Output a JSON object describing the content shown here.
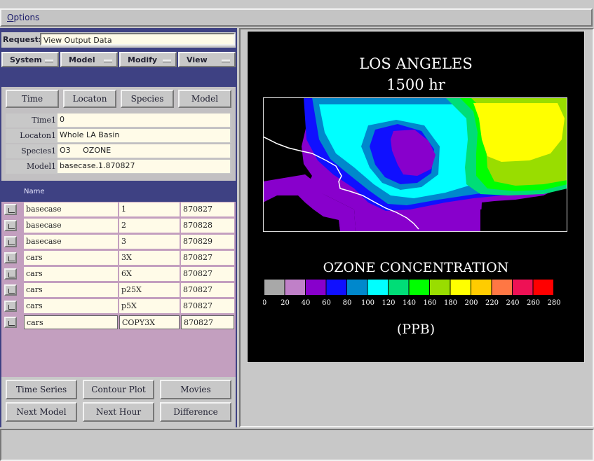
{
  "menubar": {
    "options_label": "Options",
    "options_mnemonic": "O",
    "options_rest": "ptions"
  },
  "request": {
    "label": "Request:",
    "value": "View Output Data"
  },
  "menus": [
    {
      "label": "System"
    },
    {
      "label": "Model"
    },
    {
      "label": "Modify"
    },
    {
      "label": "View"
    }
  ],
  "selectors": {
    "buttons": [
      "Time",
      "Locaton",
      "Species",
      "Model"
    ],
    "fields": [
      {
        "label": "Time1",
        "value": "0"
      },
      {
        "label": "Locaton1",
        "value": "Whole LA Basin"
      },
      {
        "label": "Species1",
        "value": "O3     OZONE"
      },
      {
        "label": "Model1",
        "value": "basecase.1.870827"
      }
    ]
  },
  "list": {
    "header": "Name",
    "rows": [
      [
        "basecase",
        "1",
        "870827"
      ],
      [
        "basecase",
        "2",
        "870828"
      ],
      [
        "basecase",
        "3",
        "870829"
      ],
      [
        "cars",
        "3X",
        "870827"
      ],
      [
        "cars",
        "6X",
        "870827"
      ],
      [
        "cars",
        "p25X",
        "870827"
      ],
      [
        "cars",
        "p5X",
        "870827"
      ],
      [
        "cars",
        "COPY3X",
        "870827"
      ]
    ]
  },
  "actions": [
    "Time Series",
    "Contour Plot",
    "Movies",
    "Next Model",
    "Next Hour",
    "Difference"
  ],
  "plot": {
    "title_line1": "LOS ANGELES",
    "title_line2": "1500 hr",
    "legend_title": "OZONE CONCENTRATION",
    "units": "(PPB)",
    "legend_ticks": [
      "0",
      "20",
      "40",
      "60",
      "80",
      "100",
      "120",
      "140",
      "160",
      "180",
      "200",
      "220",
      "240",
      "260",
      "280"
    ],
    "legend_colors": [
      "#a8a8a8",
      "#c080c8",
      "#8800cc",
      "#1010ff",
      "#0088cc",
      "#00ffff",
      "#00dd77",
      "#00ff00",
      "#99dd00",
      "#ffff00",
      "#ffcc00",
      "#ff7744",
      "#ee1155",
      "#ff0000"
    ]
  },
  "colors": {
    "panel_blue": "#3e4183",
    "list_bg": "#c39fbf",
    "field_bg": "#fffbe8"
  }
}
